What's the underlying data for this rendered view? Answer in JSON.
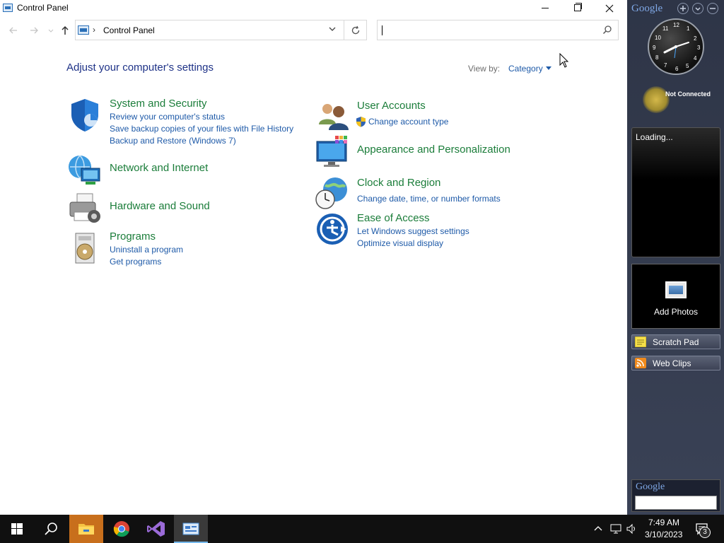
{
  "window": {
    "title": "Control Panel",
    "breadcrumb": "Control Panel",
    "breadcrumb_sep": "›"
  },
  "header": {
    "page_title": "Adjust your computer's settings",
    "view_by_label": "View by:",
    "view_by_value": "Category"
  },
  "categories_left": [
    {
      "title": "System and Security",
      "links": [
        "Review your computer's status",
        "Save backup copies of your files with File History",
        "Backup and Restore (Windows 7)"
      ]
    },
    {
      "title": "Network and Internet",
      "links": []
    },
    {
      "title": "Hardware and Sound",
      "links": []
    },
    {
      "title": "Programs",
      "links": [
        "Uninstall a program",
        "Get programs"
      ]
    }
  ],
  "categories_right": [
    {
      "title": "User Accounts",
      "links": [
        "Change account type"
      ]
    },
    {
      "title": "Appearance and Personalization",
      "links": []
    },
    {
      "title": "Clock and Region",
      "links": [
        "Change date, time, or number formats"
      ]
    },
    {
      "title": "Ease of Access",
      "links": [
        "Let Windows suggest settings",
        "Optimize visual display"
      ]
    }
  ],
  "sidebar": {
    "logo": "Google",
    "status": "Not Connected",
    "feed_status": "Loading...",
    "photos_label": "Add Photos",
    "gadgets": [
      "Scratch Pad",
      "Web Clips"
    ],
    "search_logo": "Google",
    "clock_numbers": [
      "12",
      "1",
      "2",
      "3",
      "4",
      "5",
      "6",
      "7",
      "8",
      "9",
      "10",
      "11"
    ]
  },
  "taskbar": {
    "time": "7:49 AM",
    "date": "3/10/2023",
    "notification_count": "3"
  },
  "colors": {
    "category_title": "#1b7d3a",
    "link": "#1e5aa8",
    "heading": "#1e3287",
    "sidebar_bg": "#2e3547",
    "taskbar_bg": "#101010"
  }
}
